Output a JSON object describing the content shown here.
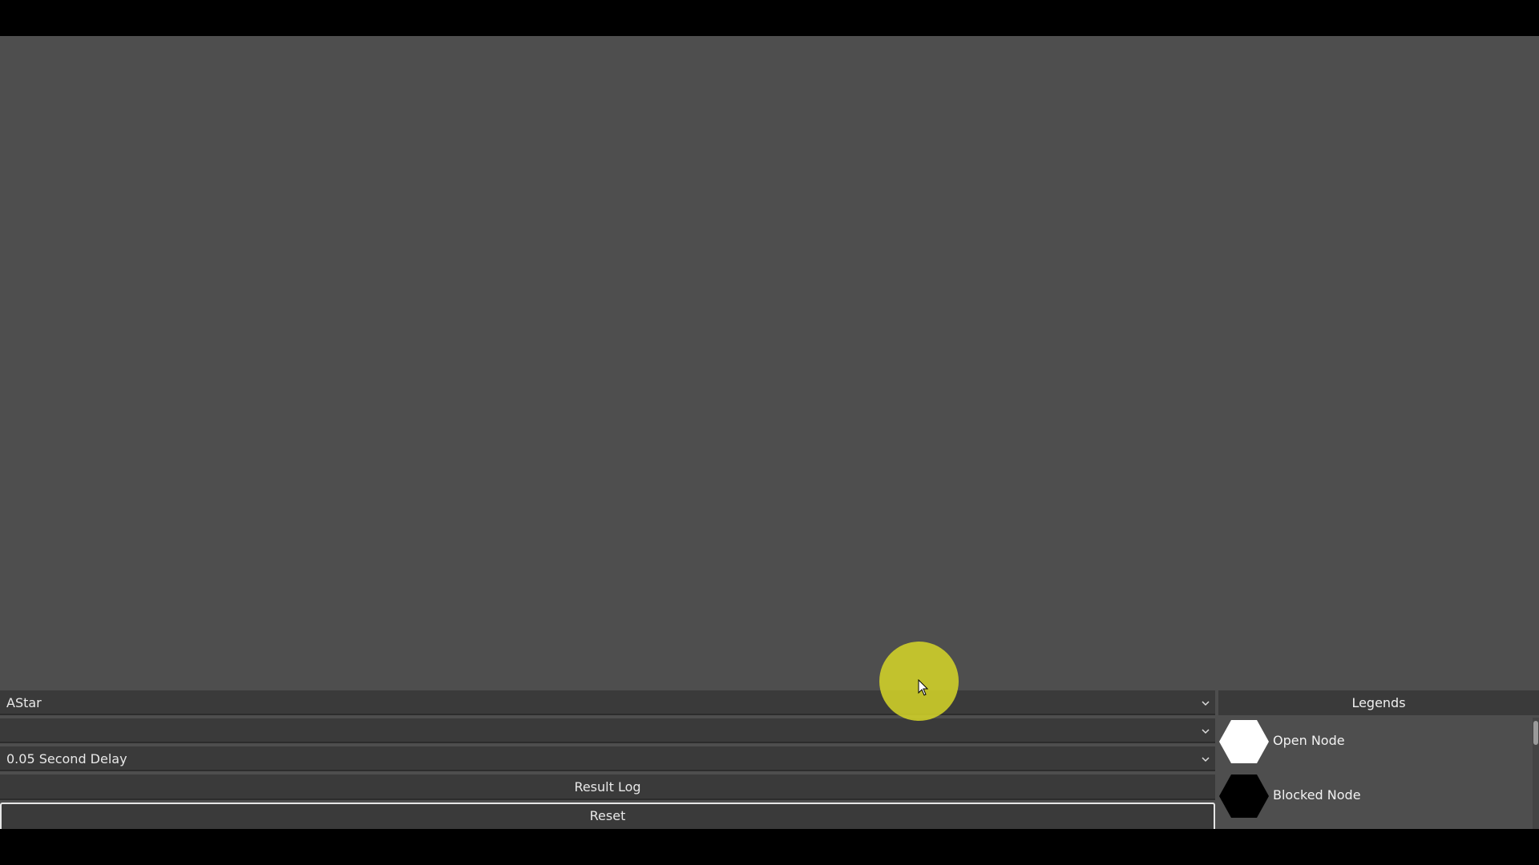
{
  "algorithm_select": {
    "value": "AStar"
  },
  "second_select": {
    "value": ""
  },
  "delay_select": {
    "value": "0.05 Second Delay"
  },
  "result_log_button": {
    "label": "Result Log"
  },
  "reset_button": {
    "label": "Reset"
  },
  "legend": {
    "title": "Legends",
    "items": [
      {
        "label": "Open Node",
        "color": "#ffffff"
      },
      {
        "label": "Blocked Node",
        "color": "#000000"
      }
    ]
  },
  "colors": {
    "background": "#4e4e4e",
    "control": "#3a3a3a",
    "cursor_highlight": "#d7d728"
  }
}
